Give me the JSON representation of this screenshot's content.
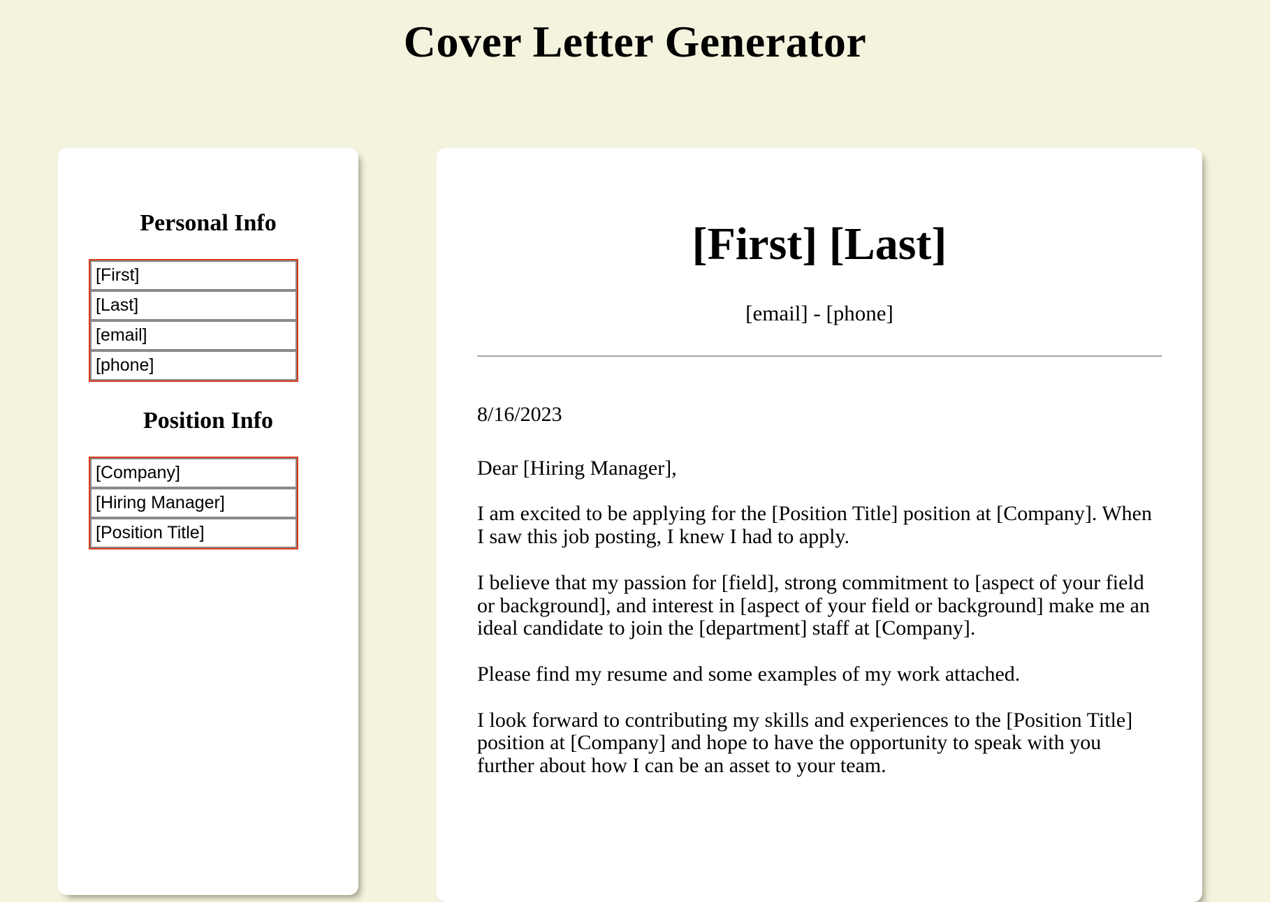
{
  "app": {
    "title": "Cover Letter Generator",
    "background_color": "#f4f3de",
    "card_color": "#ffffff",
    "group_border_color": "#d93b1c",
    "input_border_color": "#8a8a8a"
  },
  "form": {
    "personal": {
      "heading": "Personal Info",
      "fields": [
        {
          "name": "first",
          "value": "[First]",
          "placeholder": "[First]"
        },
        {
          "name": "last",
          "value": "[Last]",
          "placeholder": "[Last]"
        },
        {
          "name": "email",
          "value": "[email]",
          "placeholder": "[email]"
        },
        {
          "name": "phone",
          "value": "[phone]",
          "placeholder": "[phone]"
        }
      ]
    },
    "position": {
      "heading": "Position Info",
      "fields": [
        {
          "name": "company",
          "value": "[Company]",
          "placeholder": "[Company]"
        },
        {
          "name": "hiring_manager",
          "value": "[Hiring Manager]",
          "placeholder": "[Hiring Manager]"
        },
        {
          "name": "position_title",
          "value": "[Position Title]",
          "placeholder": "[Position Title]"
        }
      ]
    }
  },
  "letter": {
    "name": "[First] [Last]",
    "contact": "[email] - [phone]",
    "date": "8/16/2023",
    "salutation": "Dear [Hiring Manager],",
    "paragraphs": [
      "I am excited to be applying for the [Position Title] position at [Company]. When I saw this job posting, I knew I had to apply.",
      "I believe that my passion for [field], strong commitment to [aspect of your field or background], and interest in [aspect of your field or background] make me an ideal candidate to join the [department] staff at [Company].",
      "Please find my resume and some examples of my work attached.",
      "I look forward to contributing my skills and experiences to the [Position Title] position at [Company] and hope to have the opportunity to speak with you further about how I can be an asset to your team."
    ]
  }
}
